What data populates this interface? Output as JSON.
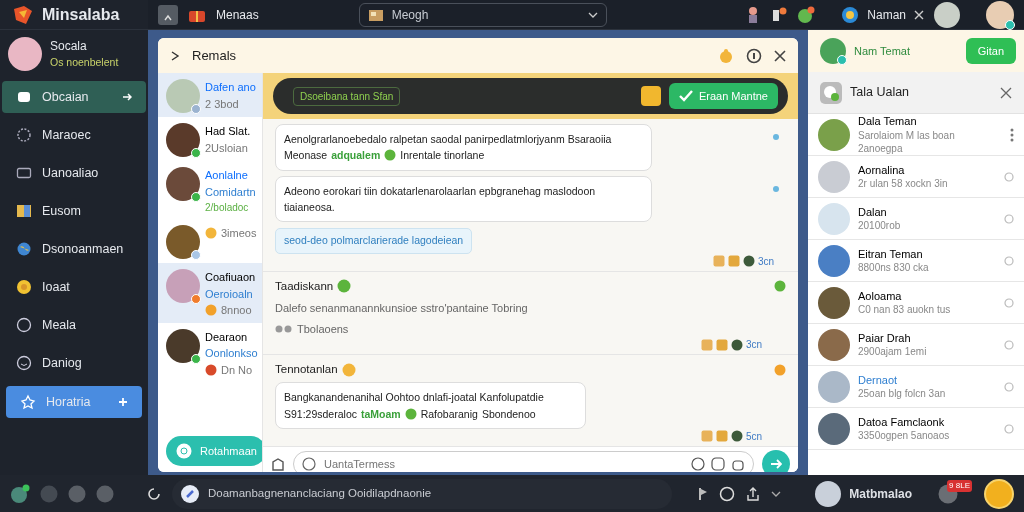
{
  "app": {
    "title": "Minsalaba"
  },
  "profile": {
    "name": "Socala",
    "status": "Os noenbelent"
  },
  "nav": [
    {
      "label": "Obcaian",
      "kind": "item",
      "selected": true
    },
    {
      "label": "Maraoec",
      "kind": "item",
      "selected": false
    },
    {
      "label": "Uanoaliao",
      "kind": "item",
      "selected": false
    },
    {
      "label": "Eusom",
      "kind": "item",
      "selected": false
    },
    {
      "label": "Dsonoanmaen",
      "kind": "item",
      "selected": false
    },
    {
      "label": "Ioaat",
      "kind": "item",
      "selected": false
    },
    {
      "label": "Meala",
      "kind": "item",
      "selected": false
    },
    {
      "label": "Daniog",
      "kind": "item",
      "selected": false
    },
    {
      "label": "Horatria",
      "kind": "action",
      "selected": false
    }
  ],
  "topbar": {
    "breadcrumb": "Menaas",
    "dropdown": {
      "value": "Meogh"
    },
    "account": {
      "name": "Naman"
    }
  },
  "chat": {
    "title": "Remals",
    "conversations": [
      {
        "name": "Dafen ano",
        "preview": "2 3bod",
        "selected": true,
        "color": "#9bb3d0"
      },
      {
        "name": "Had Slat.",
        "preview": "2Usloian",
        "selected": false,
        "color": "#3bb54a"
      },
      {
        "name": "Aonlalne",
        "preview": "Comidartn",
        "extra": "2/boladoc",
        "selected": false,
        "color": "#3bb54a"
      },
      {
        "meta": "3imeos",
        "selected": false,
        "color": "#a9c6e6"
      },
      {
        "name": "Coafiuaon",
        "preview": "Oeroioaln",
        "meta": "8nnoo",
        "selected": true,
        "color": "#f07c2c"
      },
      {
        "name": "Dearaon",
        "preview": "Oonlonkso",
        "meta": "Dn No",
        "selected": false,
        "color": "#3bb54a"
      }
    ],
    "new_button": "Rotahmaan",
    "banner": {
      "tag": "Dsoeibana tann Sfan",
      "button": "Eraan Mantne"
    },
    "messages": [
      {
        "kind": "bubble",
        "lines": [
          [
            {
              "text": "Aenolgrarlanoebedalo ralpetan saodal panirpedlatmlorjyanm Bsaraoiia",
              "kind": "plain"
            }
          ],
          [
            {
              "text": "Meonase",
              "kind": "plain"
            },
            {
              "text": "adqualem",
              "kind": "highlight"
            },
            {
              "text": "Inrentale tinorlane",
              "kind": "plain"
            }
          ]
        ]
      },
      {
        "kind": "bubble",
        "lines": [
          [
            {
              "text": "Adeono eorokari tiin dokatarlenarolaarlan epbgranehag maslodoon tiaianeosa.",
              "kind": "plain"
            }
          ]
        ]
      },
      {
        "kind": "link",
        "text": "seod-deo polmarclarierade lagodeiean",
        "time": "3cn"
      },
      {
        "kind": "post",
        "title": "Taadiskann",
        "text": "Dalefo senanmanannkunsioe sstro'pantaine Tobring",
        "meta": "Tbolaoens",
        "time": "3cn"
      },
      {
        "kind": "post",
        "title": "Tennotanlan",
        "lines": [
          [
            {
              "text": "Bangkanandenanihal Oohtoo dnlafi-joatal Kanfolupatdie",
              "kind": "plain"
            }
          ],
          [
            {
              "text": "S91:29sderaloc",
              "kind": "plain"
            },
            {
              "text": "taMoam",
              "kind": "highlight"
            },
            {
              "text": "Rafobaranig",
              "kind": "plain"
            },
            {
              "text": "Sbondenoo",
              "kind": "plain"
            }
          ]
        ],
        "time": "5cn"
      }
    ],
    "composer": {
      "placeholder": "UantaTermess"
    }
  },
  "friends_panel": {
    "header": "Nam Temat",
    "button": "Gitan",
    "title": "Tala Ualan",
    "friends": [
      {
        "name": "Dala Teman",
        "lines": [
          "Sarolaiom M las boan",
          "2anoegpa"
        ],
        "selected": false
      },
      {
        "name": "Aornalina",
        "lines": [
          "2r ulan 58 xockn 3in"
        ],
        "selected": false
      },
      {
        "name": "Dalan",
        "lines": [
          "20100rob"
        ],
        "selected": false
      },
      {
        "name": "Eitran Teman",
        "lines": [
          "8800ns 830 cka"
        ],
        "selected": false
      },
      {
        "name": "Aoloama",
        "lines": [
          "C0 nan 83 auokn tus"
        ],
        "selected": false
      },
      {
        "name": "Paiar Drah",
        "lines": [
          "2900ajam 1emi"
        ],
        "selected": false
      },
      {
        "name": "Dernaot",
        "lines": [
          "25oan blg folcn 3an"
        ],
        "selected": true
      },
      {
        "name": "Datoa Famclaonk",
        "lines": [
          "3350ogpen 5anoaos"
        ],
        "selected": false
      }
    ]
  },
  "bottombar": {
    "search": "Doamanbagnenanclaciang Ooidilapdnaonie",
    "user": "Matbmalao",
    "badge": "9 8LE"
  }
}
